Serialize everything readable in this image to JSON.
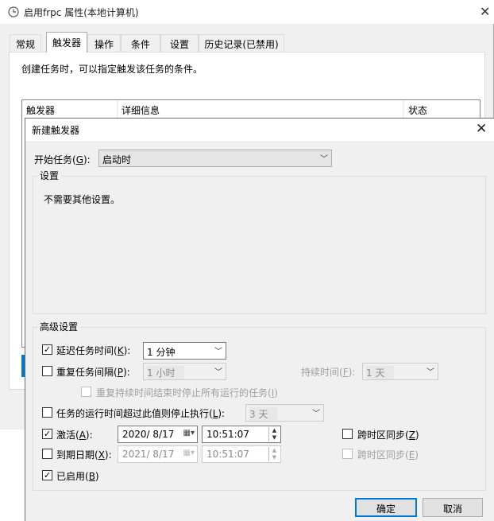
{
  "bg_window": {
    "title": "启用frpc 属性(本地计算机)",
    "tabs": [
      "常规",
      "触发器",
      "操作",
      "条件",
      "设置",
      "历史记录(已禁用)"
    ],
    "description": "创建任务时，可以指定触发该任务的条件。",
    "columns": [
      "触发器",
      "详细信息",
      "状态"
    ]
  },
  "dialog": {
    "title": "新建触发器",
    "start_task_label": "开始任务(",
    "start_task_key": "G",
    "start_task_value": "启动时",
    "settings_legend": "设置",
    "settings_text": "不需要其他设置。",
    "advanced_legend": "高级设置",
    "delay": {
      "label": "延迟任务时间(",
      "key": "K",
      "value": "1 分钟",
      "checked": true
    },
    "repeat": {
      "label": "重复任务间隔(",
      "key": "P",
      "value": "1 小时",
      "checked": false,
      "duration_label": "持续时间(",
      "duration_key": "F",
      "duration_value": "1 天"
    },
    "stop_all": {
      "label": "重复持续时间结束时停止所有运行的任务(",
      "key": "I"
    },
    "stop_if": {
      "label": "任务的运行时间超过此值则停止执行(",
      "key": "L",
      "value": "3 天",
      "checked": false
    },
    "activate": {
      "label": "激活(",
      "key": "A",
      "date": "2020/ 8/17",
      "time": "10:51:07",
      "checked": true,
      "sync_label": "跨时区同步(",
      "sync_key": "Z"
    },
    "expire": {
      "label": "到期日期(",
      "key": "X",
      "date": "2021/ 8/17",
      "time": "10:51:07",
      "checked": false,
      "sync_label": "跨时区同步(",
      "sync_key": "E"
    },
    "enabled": {
      "label": "已启用(",
      "key": "B",
      "checked": true
    },
    "ok_label": "确定",
    "cancel_label": "取消"
  },
  "icons": {
    "clock": "clock-icon",
    "close": "close-icon",
    "dropdown": "chevron-down-icon",
    "calendar": "calendar-icon",
    "spin": "spin-updown-icon"
  }
}
